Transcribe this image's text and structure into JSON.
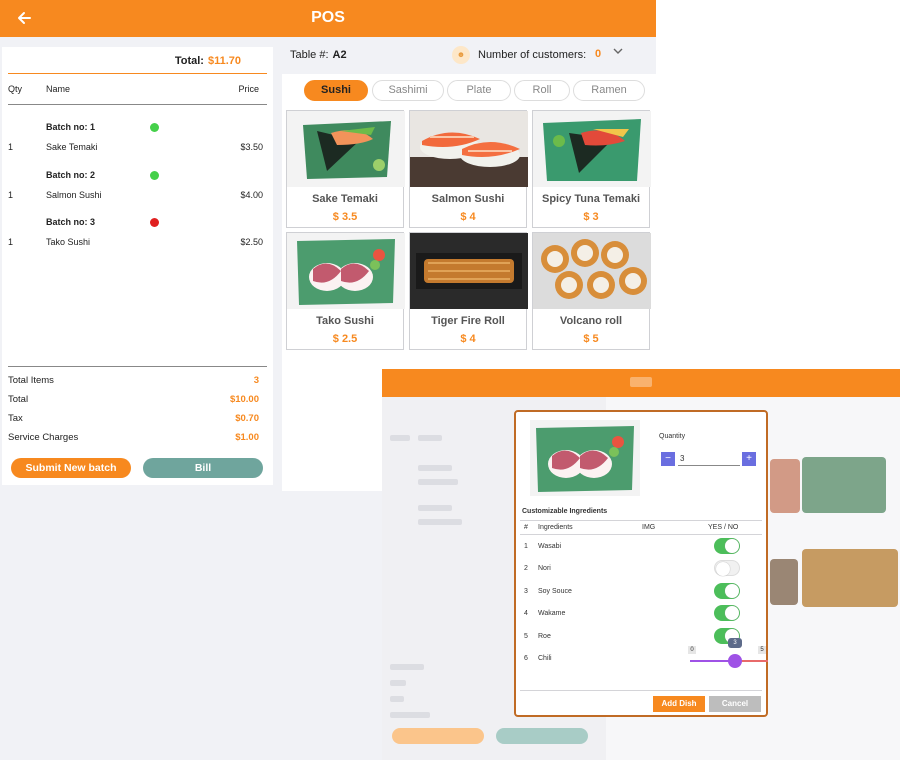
{
  "app": {
    "title": "POS"
  },
  "order": {
    "total_label": "Total:",
    "total_value": "$11.70",
    "columns": {
      "qty": "Qty",
      "name": "Name",
      "price": "Price"
    },
    "batches": [
      {
        "label": "Batch no: 1",
        "status_color": "#45d04a",
        "items": [
          {
            "qty": "1",
            "name": "Sake Temaki",
            "price": "$3.50"
          }
        ]
      },
      {
        "label": "Batch no: 2",
        "status_color": "#45d04a",
        "items": [
          {
            "qty": "1",
            "name": "Salmon Sushi",
            "price": "$4.00"
          }
        ]
      },
      {
        "label": "Batch no: 3",
        "status_color": "#e02020",
        "items": [
          {
            "qty": "1",
            "name": "Tako Sushi",
            "price": "$2.50"
          }
        ]
      }
    ],
    "summary": [
      {
        "label": "Total Items",
        "value": "3"
      },
      {
        "label": "Total",
        "value": "$10.00"
      },
      {
        "label": "Tax",
        "value": "$0.70"
      },
      {
        "label": "Service Charges",
        "value": "$1.00"
      }
    ],
    "submit_label": "Submit New batch",
    "bill_label": "Bill"
  },
  "table": {
    "label": "Table #:",
    "value": "A2"
  },
  "customers": {
    "label": "Number of customers:",
    "value": "0",
    "icon": "people-icon"
  },
  "categories": [
    "Sushi",
    "Sashimi",
    "Plate",
    "Roll",
    "Ramen"
  ],
  "active_category": "Sushi",
  "dishes": [
    {
      "name": "Sake Temaki",
      "price": "$ 3.5"
    },
    {
      "name": "Salmon Sushi",
      "price": "$ 4"
    },
    {
      "name": "Spicy Tuna Temaki",
      "price": "$ 3"
    },
    {
      "name": "Tako Sushi",
      "price": "$ 2.5"
    },
    {
      "name": "Tiger Fire Roll",
      "price": "$ 4"
    },
    {
      "name": "Volcano roll",
      "price": "$ 5"
    }
  ],
  "modal": {
    "quantity_label": "Quantity",
    "quantity_value": "3",
    "minus": "−",
    "plus": "+",
    "customizable_title": "Customizable Ingredients",
    "headers": {
      "num": "#",
      "ingredients": "Ingredients",
      "img": "IMG",
      "yesno": "YES / NO"
    },
    "ingredients": [
      {
        "num": "1",
        "name": "Wasabi",
        "on": true
      },
      {
        "num": "2",
        "name": "Nori",
        "on": false
      },
      {
        "num": "3",
        "name": "Soy Souce",
        "on": true
      },
      {
        "num": "4",
        "name": "Wakame",
        "on": true
      },
      {
        "num": "5",
        "name": "Roe",
        "on": true
      },
      {
        "num": "6",
        "name": "Chili",
        "slider": true
      }
    ],
    "chili": {
      "min": "0",
      "max": "5",
      "value": "3"
    },
    "add_label": "Add Dish",
    "cancel_label": "Cancel"
  },
  "colors": {
    "accent": "#f7891f",
    "bill": "#6fa59d",
    "toggle_on": "#4cbe5a",
    "slider": "#9f52e6"
  }
}
